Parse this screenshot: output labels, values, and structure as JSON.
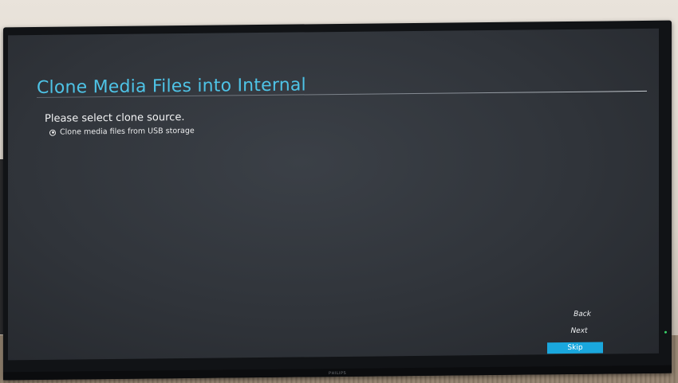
{
  "screen": {
    "title": "Clone Media Files into Internal",
    "prompt": "Please select clone source.",
    "options": [
      {
        "label": "Clone media files from USB storage",
        "selected": true
      }
    ],
    "buttons": {
      "back": "Back",
      "next": "Next",
      "skip": "Skip"
    },
    "accent_color": "#4ec3e6",
    "highlight_color": "#1aa7dd"
  },
  "monitor": {
    "brand": "PHILIPS"
  }
}
